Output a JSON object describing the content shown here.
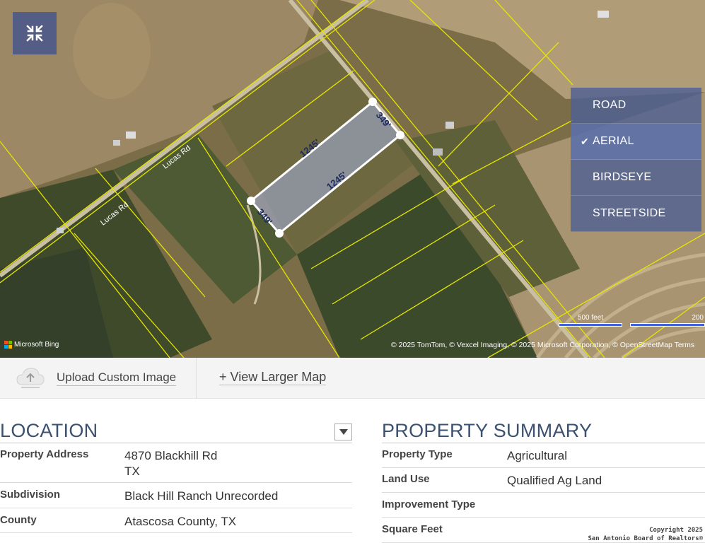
{
  "map": {
    "roads": [
      "Lucas Rd",
      "Lucas Rd"
    ],
    "measurements": {
      "long_a": "1245'",
      "long_b": "1245'",
      "short_a": "349'",
      "short_b": "349'"
    },
    "map_types": [
      {
        "label": "ROAD",
        "active": false
      },
      {
        "label": "AERIAL",
        "active": true
      },
      {
        "label": "BIRDSEYE",
        "active": false
      },
      {
        "label": "STREETSIDE",
        "active": false
      }
    ],
    "check_glyph": "✔",
    "scale_labels": [
      "500 feet",
      "200"
    ],
    "bing_label": "Microsoft Bing",
    "attribution": "© 2025 TomTom, © Vexcel Imaging, © 2025 Microsoft Corporation, © OpenStreetMap  Terms",
    "colors": {
      "parcel_line": "#e6e600",
      "measure_fill": "#a6b3e0",
      "menu_bg": "#4e6094"
    }
  },
  "toolbar": {
    "upload_label": "Upload Custom Image",
    "larger_map_label": "+ View Larger Map"
  },
  "location": {
    "title": "LOCATION",
    "rows": [
      {
        "key": "Property Address",
        "value": "4870 Blackhill Rd",
        "value2": "TX"
      },
      {
        "key": "Subdivision",
        "value": "Black Hill Ranch Unrecorded"
      },
      {
        "key": "County",
        "value": "Atascosa County, TX"
      }
    ]
  },
  "summary": {
    "title": "PROPERTY SUMMARY",
    "rows": [
      {
        "key": "Property Type",
        "value": "Agricultural"
      },
      {
        "key": "Land Use",
        "value": "Qualified Ag Land"
      },
      {
        "key": "Improvement Type",
        "value": ""
      },
      {
        "key": "Square Feet",
        "value": ""
      }
    ]
  },
  "copyright": {
    "line1": "Copyright 2025",
    "line2": "San Antonio Board of Realtors®"
  }
}
